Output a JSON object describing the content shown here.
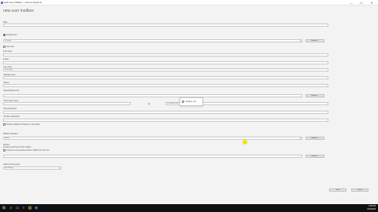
{
  "window": {
    "title": "Add User Mailbox - Internet Explorer",
    "controls": [
      "—",
      "☐",
      "✕"
    ]
  },
  "page": {
    "heading": "new user mailbox"
  },
  "form": {
    "alias_label": "Alias:",
    "alias_value": "",
    "existing_user_label": "Existing user",
    "existing_user_value": "Chicago",
    "browse_label": "Browse...",
    "new_user_label": "New user",
    "first_name_label": "First name:",
    "first_name_value": "",
    "initials_label": "Initials:",
    "last_name_label": "Last name:",
    "last_name_value": "Last name",
    "display_name_label": "*Display name:",
    "display_name_value": "",
    "name_label": "*Name:",
    "name_value": "",
    "ou_label": "Organizational unit:",
    "ou_value": "",
    "logon_name_label": "*User logon name:",
    "logon_name_value": "",
    "domain_value": "@contoso.com",
    "password_label": "*New password:",
    "password_value": "",
    "confirm_password_label": "*Confirm password:",
    "confirm_password_value": "",
    "require_change_label": "Require password change on next logon",
    "popup_checkbox_label": "Mailbox only",
    "mailbox_db_label": "Mailbox database:",
    "mailbox_db_value": "Select",
    "archive_label": "Archive:",
    "archive_hint": "Create an archive for this mailbox",
    "archive_check_label": "Create an on-premises archive mailbox for this user",
    "archive_db_value": "",
    "address_policy_label": "Address book policy:",
    "address_policy_value": "[No Policy]"
  },
  "actions": {
    "save": "Save",
    "cancel": "Cancel"
  },
  "taskbar": {
    "icons": [
      "⊞",
      "⌕",
      "▭",
      "e",
      "▤",
      "◉"
    ],
    "time": "2:08 PM",
    "date": "8/11/2015"
  }
}
